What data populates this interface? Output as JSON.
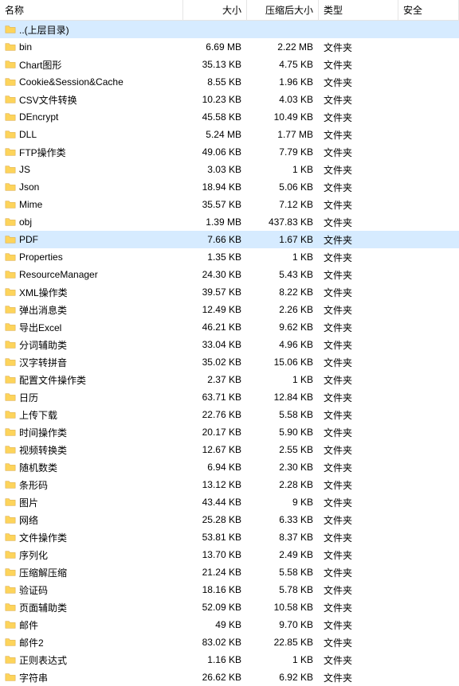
{
  "columns": {
    "name": "名称",
    "size": "大小",
    "packed": "压缩后大小",
    "type": "类型",
    "security": "安全"
  },
  "type_folder": "文件夹",
  "parent": {
    "label": "..(上层目录)"
  },
  "rows": [
    {
      "name": "bin",
      "size": "6.69 MB",
      "packed": "2.22 MB",
      "sel": false
    },
    {
      "name": "Chart图形",
      "size": "35.13 KB",
      "packed": "4.75 KB",
      "sel": false
    },
    {
      "name": "Cookie&Session&Cache",
      "size": "8.55 KB",
      "packed": "1.96 KB",
      "sel": false
    },
    {
      "name": "CSV文件转换",
      "size": "10.23 KB",
      "packed": "4.03 KB",
      "sel": false
    },
    {
      "name": "DEncrypt",
      "size": "45.58 KB",
      "packed": "10.49 KB",
      "sel": false
    },
    {
      "name": "DLL",
      "size": "5.24 MB",
      "packed": "1.77 MB",
      "sel": false
    },
    {
      "name": "FTP操作类",
      "size": "49.06 KB",
      "packed": "7.79 KB",
      "sel": false
    },
    {
      "name": "JS",
      "size": "3.03 KB",
      "packed": "1 KB",
      "sel": false
    },
    {
      "name": "Json",
      "size": "18.94 KB",
      "packed": "5.06 KB",
      "sel": false
    },
    {
      "name": "Mime",
      "size": "35.57 KB",
      "packed": "7.12 KB",
      "sel": false
    },
    {
      "name": "obj",
      "size": "1.39 MB",
      "packed": "437.83 KB",
      "sel": false
    },
    {
      "name": "PDF",
      "size": "7.66 KB",
      "packed": "1.67 KB",
      "sel": true
    },
    {
      "name": "Properties",
      "size": "1.35 KB",
      "packed": "1 KB",
      "sel": false
    },
    {
      "name": "ResourceManager",
      "size": "24.30 KB",
      "packed": "5.43 KB",
      "sel": false
    },
    {
      "name": "XML操作类",
      "size": "39.57 KB",
      "packed": "8.22 KB",
      "sel": false
    },
    {
      "name": "弹出消息类",
      "size": "12.49 KB",
      "packed": "2.26 KB",
      "sel": false
    },
    {
      "name": "导出Excel",
      "size": "46.21 KB",
      "packed": "9.62 KB",
      "sel": false
    },
    {
      "name": "分词辅助类",
      "size": "33.04 KB",
      "packed": "4.96 KB",
      "sel": false
    },
    {
      "name": "汉字转拼音",
      "size": "35.02 KB",
      "packed": "15.06 KB",
      "sel": false
    },
    {
      "name": "配置文件操作类",
      "size": "2.37 KB",
      "packed": "1 KB",
      "sel": false
    },
    {
      "name": "日历",
      "size": "63.71 KB",
      "packed": "12.84 KB",
      "sel": false
    },
    {
      "name": "上传下载",
      "size": "22.76 KB",
      "packed": "5.58 KB",
      "sel": false
    },
    {
      "name": "时间操作类",
      "size": "20.17 KB",
      "packed": "5.90 KB",
      "sel": false
    },
    {
      "name": "视频转换类",
      "size": "12.67 KB",
      "packed": "2.55 KB",
      "sel": false
    },
    {
      "name": "随机数类",
      "size": "6.94 KB",
      "packed": "2.30 KB",
      "sel": false
    },
    {
      "name": "条形码",
      "size": "13.12 KB",
      "packed": "2.28 KB",
      "sel": false
    },
    {
      "name": "图片",
      "size": "43.44 KB",
      "packed": "9 KB",
      "sel": false
    },
    {
      "name": "网络",
      "size": "25.28 KB",
      "packed": "6.33 KB",
      "sel": false
    },
    {
      "name": "文件操作类",
      "size": "53.81 KB",
      "packed": "8.37 KB",
      "sel": false
    },
    {
      "name": "序列化",
      "size": "13.70 KB",
      "packed": "2.49 KB",
      "sel": false
    },
    {
      "name": "压缩解压缩",
      "size": "21.24 KB",
      "packed": "5.58 KB",
      "sel": false
    },
    {
      "name": "验证码",
      "size": "18.16 KB",
      "packed": "5.78 KB",
      "sel": false
    },
    {
      "name": "页面辅助类",
      "size": "52.09 KB",
      "packed": "10.58 KB",
      "sel": false
    },
    {
      "name": "邮件",
      "size": "49 KB",
      "packed": "9.70 KB",
      "sel": false
    },
    {
      "name": "邮件2",
      "size": "83.02 KB",
      "packed": "22.85 KB",
      "sel": false
    },
    {
      "name": "正则表达式",
      "size": "1.16 KB",
      "packed": "1 KB",
      "sel": false
    },
    {
      "name": "字符串",
      "size": "26.62 KB",
      "packed": "6.92 KB",
      "sel": false
    }
  ]
}
